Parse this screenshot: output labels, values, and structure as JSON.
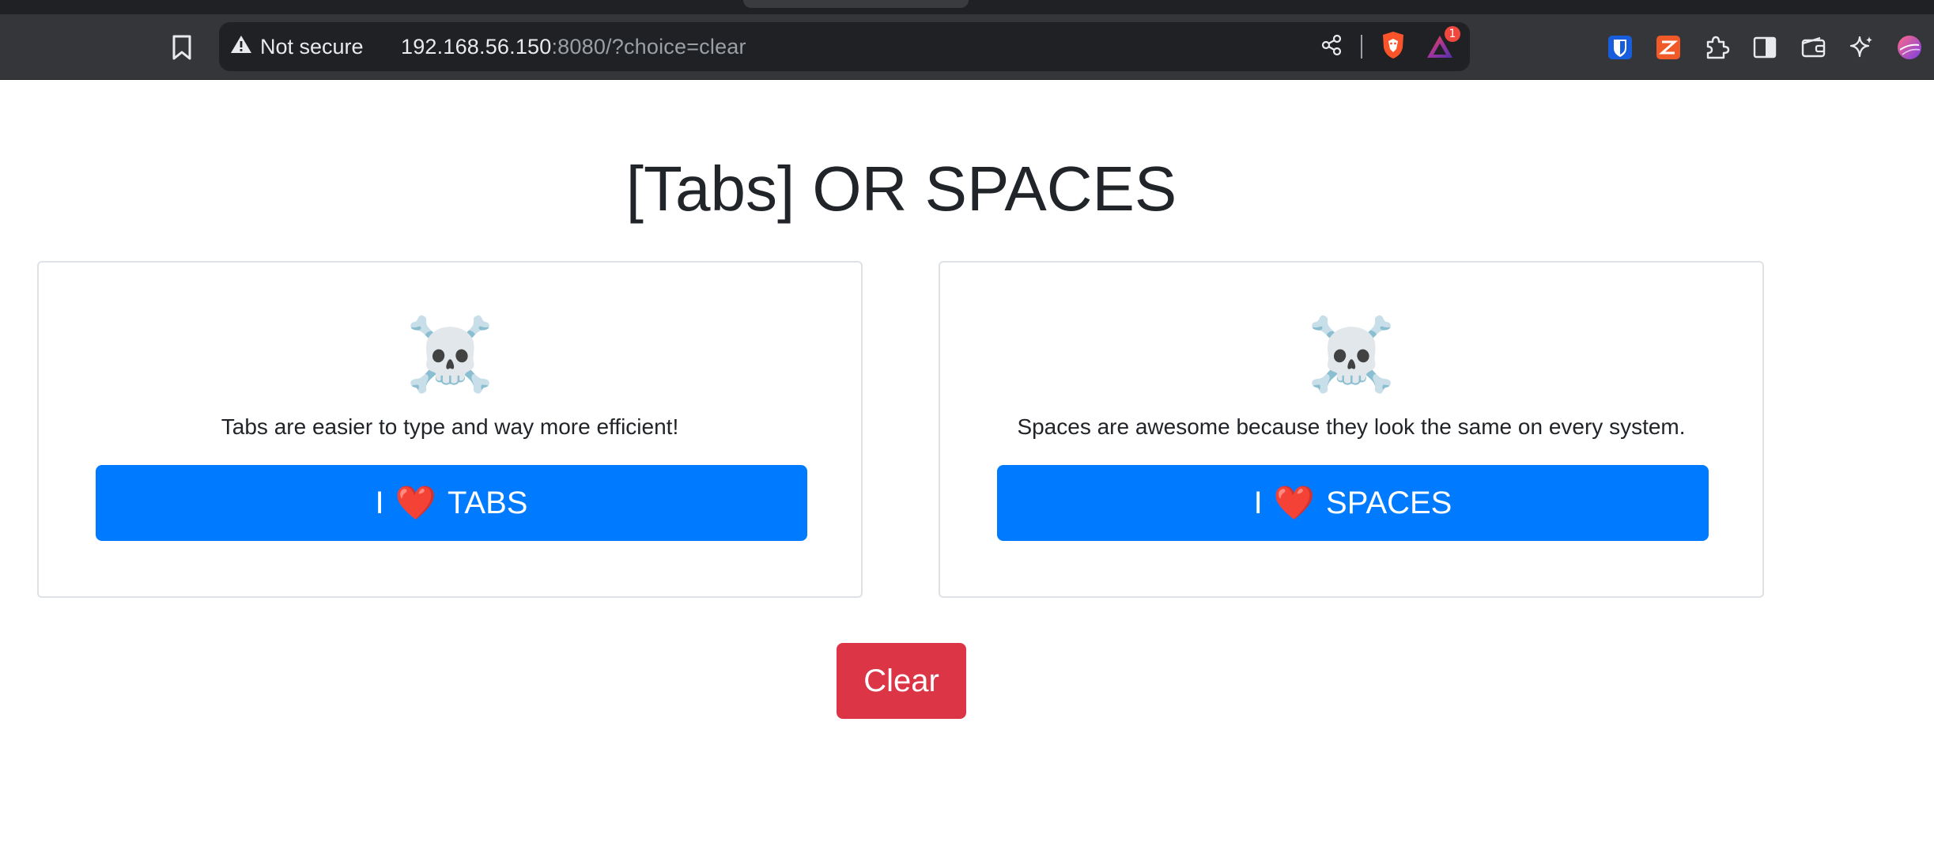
{
  "browser": {
    "security_label": "Not secure",
    "url_host": "192.168.56.150",
    "url_rest": ":8080/?choice=clear",
    "notification_count": "1",
    "icons": [
      "bookmark-icon",
      "warning-icon",
      "share-icon",
      "brave-shields-icon",
      "brave-rewards-icon",
      "bitwarden-icon",
      "extension-z-icon",
      "puzzle-icon",
      "sidebar-icon",
      "wallet-icon",
      "leo-ai-icon",
      "profile-avatar-icon"
    ],
    "colors": {
      "chrome": "#35363a",
      "omnibox": "#202124",
      "brave_orange": "#fb542b"
    }
  },
  "page": {
    "title": "[Tabs] OR SPACES",
    "cards": [
      {
        "emoji": "☠️",
        "text": "Tabs are easier to type and way more efficient!",
        "button_prefix": "I",
        "button_heart": "❤️",
        "button_suffix": "TABS"
      },
      {
        "emoji": "☠️",
        "text": "Spaces are awesome because they look the same on every system.",
        "button_prefix": "I",
        "button_heart": "❤️",
        "button_suffix": "SPACES"
      }
    ],
    "clear_label": "Clear",
    "colors": {
      "primary": "#007bff",
      "danger": "#dc3545",
      "card_border": "#dee2e6"
    }
  }
}
